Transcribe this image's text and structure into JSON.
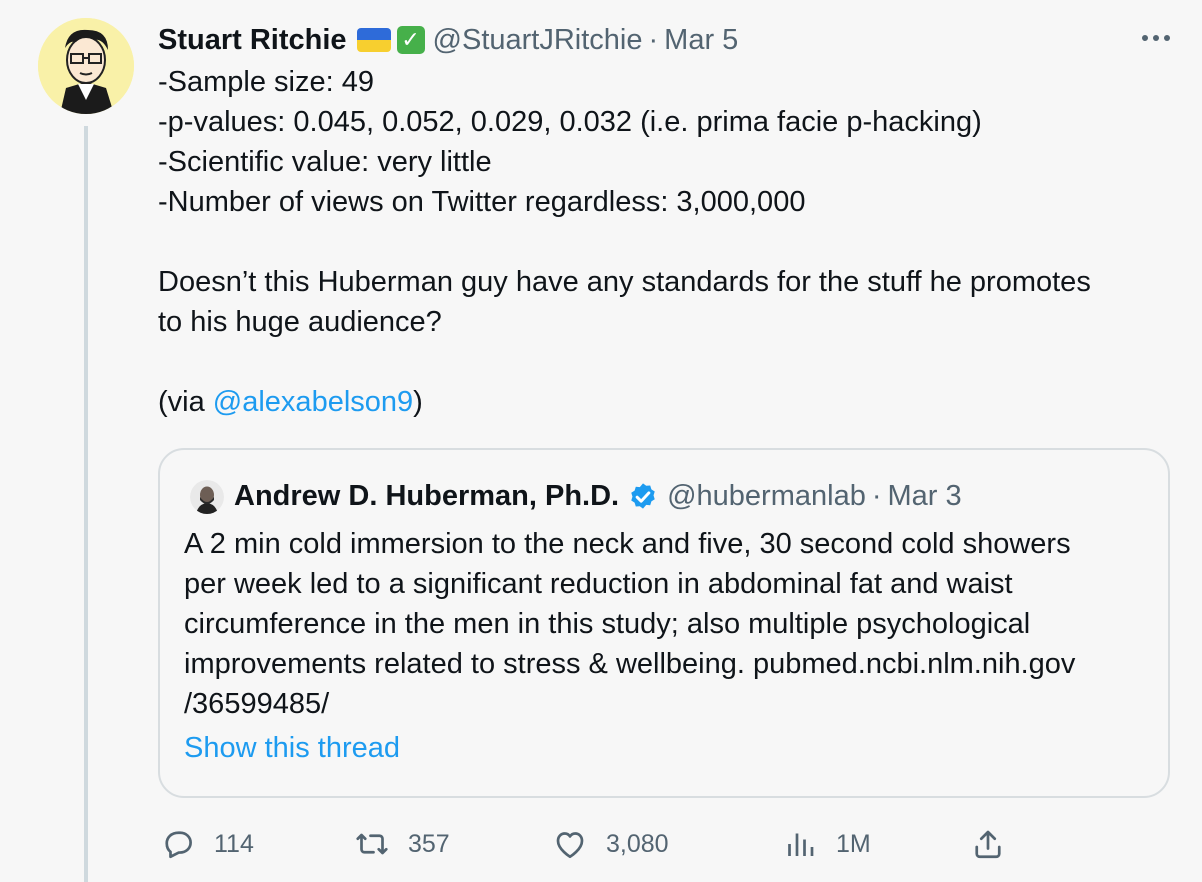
{
  "tweet": {
    "author": {
      "name": "Stuart Ritchie",
      "handle": "@StuartJRitchie",
      "date": "Mar 5",
      "separator": "·",
      "check": "✓",
      "flag_colors": [
        "#2e6bd9",
        "#f7cf2f"
      ]
    },
    "more_label": "···",
    "body_lines": [
      "-Sample size: 49",
      "-p-values: 0.045, 0.052, 0.029, 0.032 (i.e. prima facie p-hacking)",
      "-Scientific value: very little",
      "-Number of views on Twitter regardless: 3,000,000",
      "",
      "Doesn’t this Huberman guy have any standards for the stuff he promotes",
      "to his huge audience?",
      ""
    ],
    "via_prefix": "(via ",
    "via_mention": "@alexabelson9",
    "via_suffix": ")"
  },
  "quote": {
    "name": "Andrew D. Huberman, Ph.D.",
    "handle": "@hubermanlab",
    "separator": "·",
    "date": "Mar 3",
    "text_lines": [
      "A 2 min cold immersion to the neck and five, 30 second cold showers",
      "per week led to a significant reduction in abdominal fat and waist",
      "circumference in the men in this study; also multiple psychological",
      "improvements related to stress & wellbeing. pubmed.ncbi.nlm.nih.gov",
      "/36599485/"
    ],
    "show_thread": "Show this thread"
  },
  "actions": {
    "replies": "114",
    "retweets": "357",
    "likes": "3,080",
    "views": "1M"
  },
  "colors": {
    "background": "#f7f7f7",
    "link": "#1d9bf0",
    "muted": "#536471",
    "text": "#0f1419",
    "verified": "#1d9bf0",
    "check_badge": "#46b04a"
  },
  "icons": {
    "more": "more-horizontal-icon",
    "reply": "reply-bubble-icon",
    "retweet": "retweet-icon",
    "like": "heart-icon",
    "views": "views-bars-icon",
    "share": "share-upload-icon"
  }
}
